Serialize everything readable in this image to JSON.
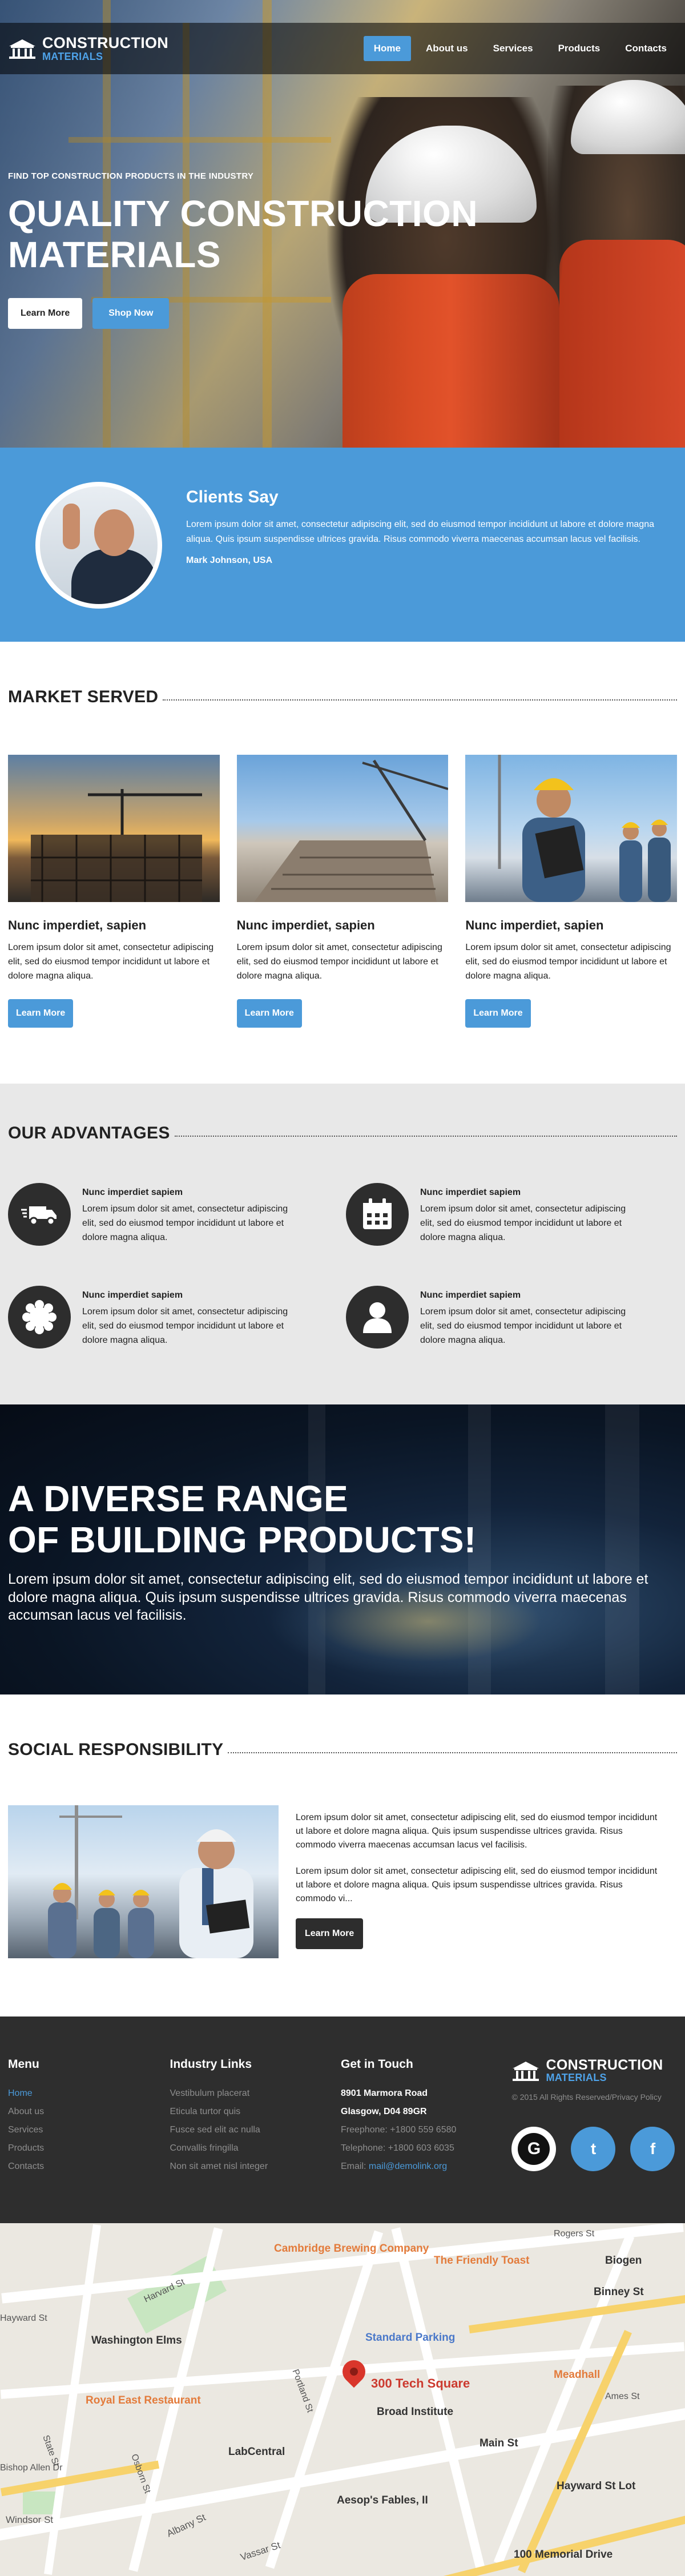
{
  "brand": {
    "line1": "CONSTRUCTION",
    "line2": "MATERIALS"
  },
  "nav": [
    {
      "label": "Home",
      "active": true
    },
    {
      "label": "About us",
      "active": false
    },
    {
      "label": "Services",
      "active": false
    },
    {
      "label": "Products",
      "active": false
    },
    {
      "label": "Contacts",
      "active": false
    }
  ],
  "hero": {
    "eyebrow": "FIND TOP CONSTRUCTION PRODUCTS IN THE INDUSTRY",
    "title_line1": "QUALITY CONSTRUCTION",
    "title_line2": "MATERIALS",
    "btn_learn": "Learn More",
    "btn_shop": "Shop Now"
  },
  "testimonial": {
    "heading": "Clients Say",
    "text": "Lorem ipsum dolor sit amet, consectetur adipiscing elit, sed do eiusmod tempor incididunt ut labore et dolore magna aliqua. Quis ipsum suspendisse ultrices gravida. Risus commodo viverra maecenas accumsan lacus vel facilisis.",
    "author": "Mark Johnson, USA"
  },
  "market": {
    "title": "MARKET SERVED",
    "cards": [
      {
        "title": "Nunc imperdiet, sapien",
        "text": "Lorem ipsum dolor sit amet, consectetur adipiscing elit, sed do eiusmod tempor incididunt ut labore et dolore magna aliqua.",
        "button": "Learn More"
      },
      {
        "title": "Nunc imperdiet, sapien",
        "text": "Lorem ipsum dolor sit amet, consectetur adipiscing elit, sed do eiusmod tempor incididunt ut labore et dolore magna aliqua.",
        "button": "Learn More"
      },
      {
        "title": "Nunc imperdiet, sapien",
        "text": "Lorem ipsum dolor sit amet, consectetur adipiscing elit, sed do eiusmod tempor incididunt ut labore et dolore magna aliqua.",
        "button": "Learn More"
      }
    ]
  },
  "advantages": {
    "title": "OUR ADVANTAGES",
    "items": [
      {
        "icon": "truck-icon",
        "title": "Nunc imperdiet sapiem",
        "text": "Lorem ipsum dolor sit amet, consectetur adipiscing elit, sed do eiusmod tempor incididunt ut labore et dolore magna aliqua."
      },
      {
        "icon": "calendar-icon",
        "title": "Nunc imperdiet sapiem",
        "text": "Lorem ipsum dolor sit amet, consectetur adipiscing elit, sed do eiusmod tempor incididunt ut labore et dolore magna aliqua."
      },
      {
        "icon": "gear-icon",
        "title": "Nunc imperdiet sapiem",
        "text": "Lorem ipsum dolor sit amet, consectetur adipiscing elit, sed do eiusmod tempor incididunt ut labore et dolore magna aliqua."
      },
      {
        "icon": "user-icon",
        "title": "Nunc imperdiet sapiem",
        "text": "Lorem ipsum dolor sit amet, consectetur adipiscing elit, sed do eiusmod tempor incididunt ut labore et dolore magna aliqua."
      }
    ]
  },
  "range": {
    "title_line1": "A DIVERSE RANGE",
    "title_line2": "OF BUILDING PRODUCTS!",
    "text": "Lorem ipsum dolor sit amet, consectetur adipiscing elit, sed do eiusmod tempor incididunt ut labore et dolore magna aliqua. Quis ipsum suspendisse ultrices gravida. Risus commodo viverra maecenas accumsan lacus vel facilisis."
  },
  "social": {
    "title": "SOCIAL RESPONSIBILITY",
    "p1": "Lorem ipsum dolor sit amet, consectetur adipiscing elit, sed do eiusmod tempor incididunt ut labore et dolore magna aliqua. Quis ipsum suspendisse ultrices gravida. Risus commodo viverra maecenas accumsan lacus vel facilisis.",
    "p2": "Lorem ipsum dolor sit amet, consectetur adipiscing elit, sed do eiusmod tempor incididunt ut labore et dolore magna aliqua. Quis ipsum suspendisse ultrices gravida. Risus commodo vi...",
    "button": "Learn More"
  },
  "footer": {
    "menu_title": "Menu",
    "menu": [
      "Home",
      "About us",
      "Services",
      "Products",
      "Contacts"
    ],
    "links_title": "Industry Links",
    "links": [
      "Vestibulum placerat",
      "Eticula turtor quis",
      "Fusce sed elit ac nulla",
      "Convallis fringilla",
      "Non sit amet nisl integer"
    ],
    "touch_title": "Get in Touch",
    "address1": "8901 Marmora Road",
    "address2": "Glasgow, D04 89GR",
    "freephone": "Freephone: +1800 559 6580",
    "telephone": "Telephone: +1800 603 6035",
    "email_label": "Email: ",
    "email": "mail@demolink.org",
    "copyright": "© 2015 All Rights Reserved/Privacy Policy",
    "social": [
      "G",
      "t",
      "f"
    ]
  },
  "map": {
    "labels": [
      "Cambridge Brewing Company",
      "The Friendly Toast",
      "Biogen",
      "Rogers St",
      "Binney St",
      "Harvard St",
      "Washington Elms",
      "Standard Parking",
      "300 Tech Square",
      "Meadhall",
      "Broad Institute",
      "Royal East Restaurant",
      "Main St",
      "LabCentral",
      "Aesop's Fables, II",
      "Hayward St Lot",
      "100 Memorial Drive",
      "Windsor St",
      "Vassar St",
      "Albany St",
      "Portland St",
      "State St",
      "Bishop Allen Dr",
      "Osborn St",
      "Hayward St",
      "Ames St"
    ]
  }
}
